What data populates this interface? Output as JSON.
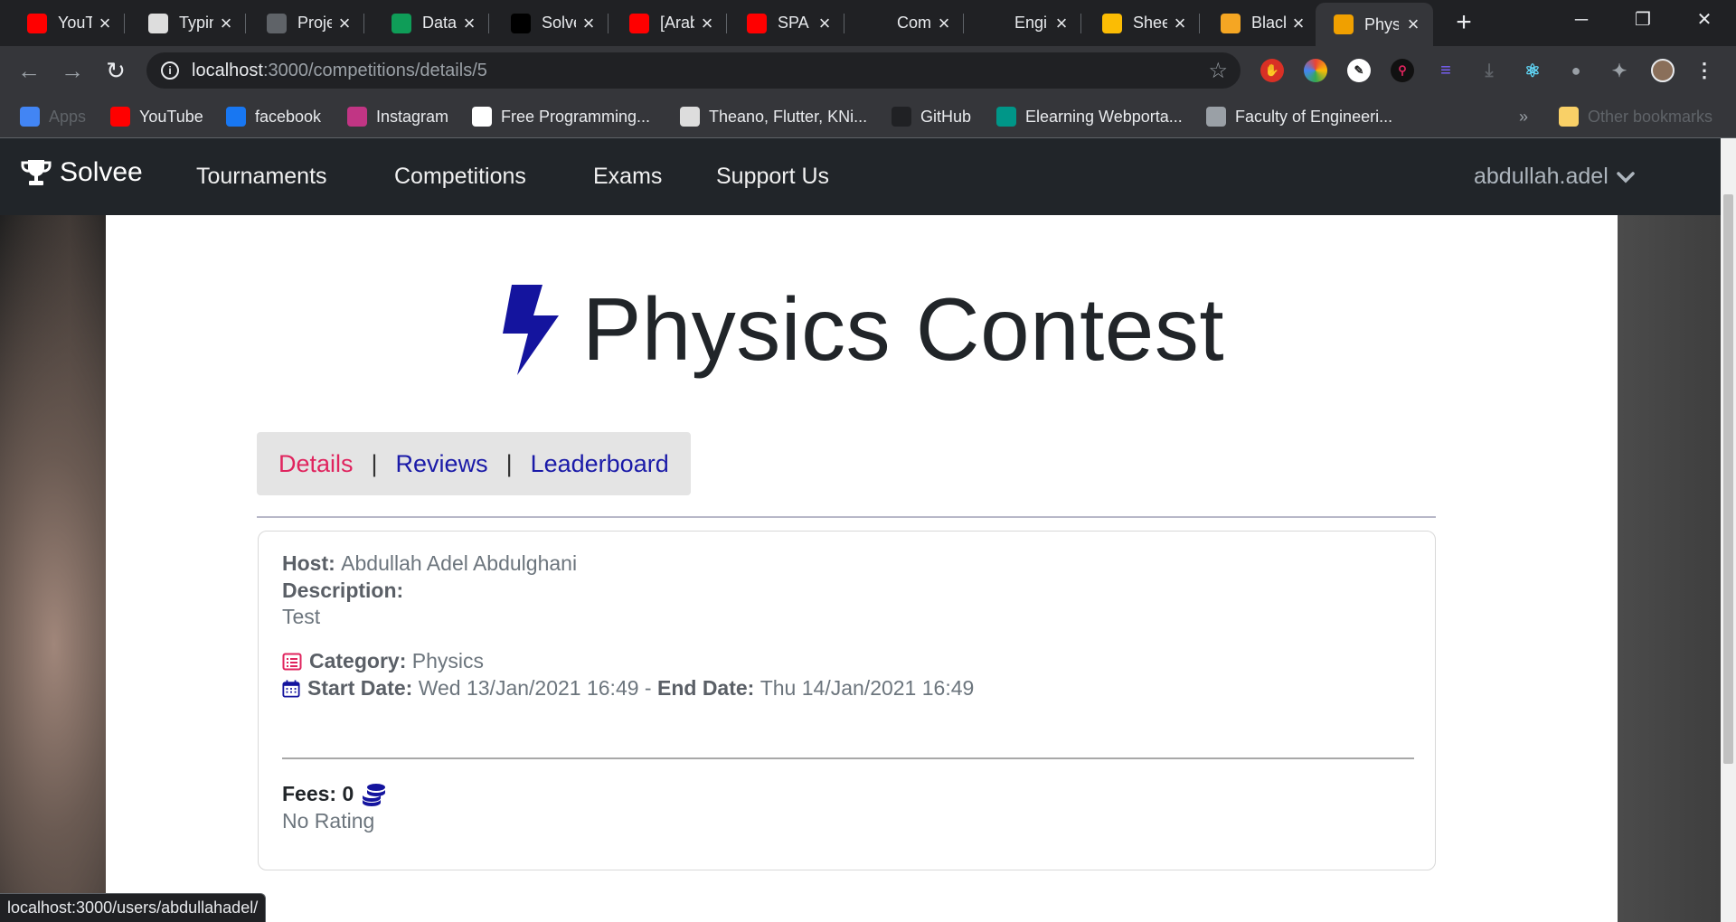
{
  "browser": {
    "tabs": [
      {
        "title": "YouTube",
        "icon": "youtube-icon",
        "color": "#ff0000"
      },
      {
        "title": "Typing",
        "icon": "typing-icon",
        "color": "#dddddd"
      },
      {
        "title": "Project",
        "icon": "classroom-icon",
        "color": "#5f6368"
      },
      {
        "title": "Data",
        "icon": "sheets-icon",
        "color": "#0f9d58"
      },
      {
        "title": "Solve",
        "icon": "hackerrank-icon",
        "color": "#000000"
      },
      {
        "title": "[Arabic",
        "icon": "youtube-icon",
        "color": "#ff0000"
      },
      {
        "title": "SPA",
        "icon": "youtube-icon",
        "color": "#ff0000"
      },
      {
        "title": "Com",
        "icon": "github-icon",
        "color": "#202124"
      },
      {
        "title": "Engi",
        "icon": "github-icon",
        "color": "#202124"
      },
      {
        "title": "Shee",
        "icon": "drive-icon",
        "color": "#fbbc04"
      },
      {
        "title": "Black",
        "icon": "notepad-icon",
        "color": "#f5a623"
      },
      {
        "title": "Phys",
        "icon": "trophy-icon",
        "color": "#f0a000",
        "active": true
      }
    ],
    "new_tab": "+",
    "window_controls": {
      "minimize": "─",
      "restore": "❐",
      "close": "✕"
    },
    "url_host": "localhost",
    "url_path": ":3000/competitions/details/5",
    "bookmarks": [
      {
        "label": "Apps",
        "icon": "apps-grid-icon",
        "color": "#4285f4"
      },
      {
        "label": "YouTube",
        "icon": "youtube-icon",
        "color": "#ff0000"
      },
      {
        "label": "facebook",
        "icon": "facebook-icon",
        "color": "#1877f2"
      },
      {
        "label": "Instagram",
        "icon": "instagram-icon",
        "color": "#c13584"
      },
      {
        "label": "Free Programming...",
        "icon": "freecodecamp-icon",
        "color": "#ffffff"
      },
      {
        "label": "Theano, Flutter, KNi...",
        "icon": "theano-icon",
        "color": "#dddddd"
      },
      {
        "label": "GitHub",
        "icon": "github-icon",
        "color": "#202124"
      },
      {
        "label": "Elearning Webporta...",
        "icon": "elearning-icon",
        "color": "#009688"
      },
      {
        "label": "Faculty of Engineeri...",
        "icon": "globe-icon",
        "color": "#9aa0a6"
      }
    ],
    "bookmarks_overflow": "»",
    "other_bookmarks": "Other bookmarks",
    "status_url": "localhost:3000/users/abdullahadel/"
  },
  "site": {
    "brand": "Solvee",
    "nav": [
      "Tournaments",
      "Competitions",
      "Exams",
      "Support Us"
    ],
    "user": "abdullah.adel"
  },
  "competition": {
    "title": "Physics Contest",
    "tabs": {
      "details": "Details",
      "reviews": "Reviews",
      "leaderboard": "Leaderboard",
      "separator": "|"
    },
    "host_label": "Host:",
    "host": "Abdullah Adel Abdulghani",
    "description_label": "Description:",
    "description": "Test",
    "category_label": "Category:",
    "category": "Physics",
    "start_label": "Start Date:",
    "start": "Wed 13/Jan/2021 16:49",
    "dash": "-",
    "end_label": "End Date:",
    "end": "Thu 14/Jan/2021 16:49",
    "fees_label": "Fees:",
    "fees": "0",
    "rating": "No Rating"
  },
  "colors": {
    "accent_pink": "#e0245e",
    "accent_blue": "#1a1aa8",
    "nav_bg": "#212529"
  }
}
